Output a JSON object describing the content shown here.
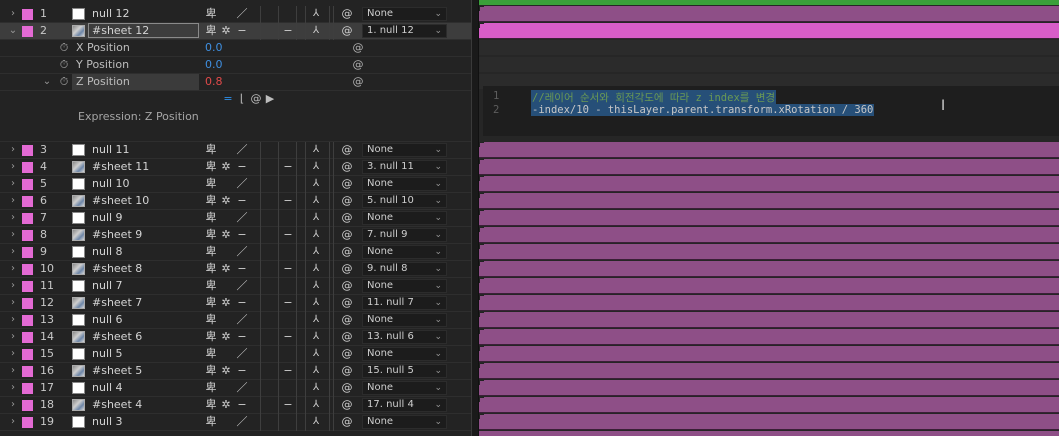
{
  "layers": [
    {
      "num": "1",
      "name": "null 12",
      "type": "null",
      "switch3": "／",
      "parent": "None"
    },
    {
      "num": "2",
      "name": "#sheet 12",
      "type": "sheet",
      "switch3": "−",
      "parent": "1. null 12",
      "selected": true
    },
    {
      "num": "3",
      "name": "null 11",
      "type": "null",
      "switch3": "／",
      "parent": "None"
    },
    {
      "num": "4",
      "name": "#sheet 11",
      "type": "sheet",
      "switch3": "−",
      "parent": "3. null 11"
    },
    {
      "num": "5",
      "name": "null 10",
      "type": "null",
      "switch3": "／",
      "parent": "None"
    },
    {
      "num": "6",
      "name": "#sheet 10",
      "type": "sheet",
      "switch3": "−",
      "parent": "5. null 10"
    },
    {
      "num": "7",
      "name": "null 9",
      "type": "null",
      "switch3": "／",
      "parent": "None"
    },
    {
      "num": "8",
      "name": "#sheet 9",
      "type": "sheet",
      "switch3": "−",
      "parent": "7. null 9"
    },
    {
      "num": "9",
      "name": "null 8",
      "type": "null",
      "switch3": "／",
      "parent": "None"
    },
    {
      "num": "10",
      "name": "#sheet 8",
      "type": "sheet",
      "switch3": "−",
      "parent": "9. null 8"
    },
    {
      "num": "11",
      "name": "null 7",
      "type": "null",
      "switch3": "／",
      "parent": "None"
    },
    {
      "num": "12",
      "name": "#sheet 7",
      "type": "sheet",
      "switch3": "−",
      "parent": "11. null 7"
    },
    {
      "num": "13",
      "name": "null 6",
      "type": "null",
      "switch3": "／",
      "parent": "None"
    },
    {
      "num": "14",
      "name": "#sheet 6",
      "type": "sheet",
      "switch3": "−",
      "parent": "13. null 6"
    },
    {
      "num": "15",
      "name": "null 5",
      "type": "null",
      "switch3": "／",
      "parent": "None"
    },
    {
      "num": "16",
      "name": "#sheet 5",
      "type": "sheet",
      "switch3": "−",
      "parent": "15. null 5"
    },
    {
      "num": "17",
      "name": "null 4",
      "type": "null",
      "switch3": "／",
      "parent": "None"
    },
    {
      "num": "18",
      "name": "#sheet 4",
      "type": "sheet",
      "switch3": "−",
      "parent": "17. null 4"
    },
    {
      "num": "19",
      "name": "null 3",
      "type": "null",
      "switch3": "／",
      "parent": "None"
    }
  ],
  "properties": [
    {
      "label": "X Position",
      "value": "0.0",
      "color": "blue"
    },
    {
      "label": "Y Position",
      "value": "0.0",
      "color": "blue"
    },
    {
      "label": "Z Position",
      "value": "0.8",
      "color": "red",
      "highlight": true
    }
  ],
  "expression": {
    "label": "Expression: Z Position",
    "lines": [
      {
        "n": "1",
        "text": "//레이어 순서와 회전각도에 따라 z index를 변경"
      },
      {
        "n": "2",
        "text": "-index/10 - thisLayer.parent.transform.xRotation / 360"
      }
    ]
  },
  "icons": {
    "expand": "chevron-right-icon",
    "stopwatch": "stopwatch-icon",
    "pickwhip": "spiral-pickwhip-icon",
    "dropdown": "chevron-down-icon"
  },
  "colors": {
    "label": "#e36ad4",
    "bar": "#8e4f87",
    "bar_selected": "#d85dc8",
    "value_blue": "#3f8fe0",
    "value_red": "#e04a4a"
  }
}
